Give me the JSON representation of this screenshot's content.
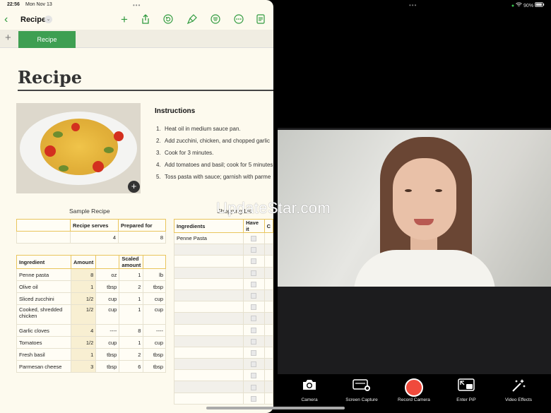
{
  "left_status": {
    "time": "22:56",
    "date": "Mon Nov 13"
  },
  "toolbar": {
    "title": "Recipe",
    "icons": [
      "back-chevron-icon",
      "add-icon",
      "share-icon",
      "undo-icon",
      "format-brush-icon",
      "menu-icon",
      "more-icon",
      "document-icon"
    ]
  },
  "sheet_tab": "Recipe",
  "heading": "Recipe",
  "instructions": {
    "title": "Instructions",
    "steps": [
      "Heat oil in medium sauce pan.",
      "Add zucchini, chicken, and chopped garlic",
      "Cook for 3 minutes.",
      "Add tomatoes and basil; cook for 5 minutes",
      "Toss pasta with sauce; garnish with parme"
    ]
  },
  "sample_caption": "Sample Recipe",
  "shopping_caption": "Shopping List",
  "serves_table": {
    "headers": [
      "",
      "Recipe serves",
      "Prepared for"
    ],
    "row": [
      "",
      "4",
      "8"
    ]
  },
  "ingredients_table": {
    "headers": [
      "Ingredient",
      "Amount",
      "",
      "Scaled amount",
      ""
    ],
    "rows": [
      [
        "Penne pasta",
        "8",
        "oz",
        "1",
        "lb"
      ],
      [
        "Olive oil",
        "1",
        "tbsp",
        "2",
        "tbsp"
      ],
      [
        "Sliced zucchini",
        "1/2",
        "cup",
        "1",
        "cup"
      ],
      [
        "Cooked, shredded chicken",
        "1/2",
        "cup",
        "1",
        "cup"
      ],
      [
        "Garlic cloves",
        "4",
        "----",
        "8",
        "----"
      ],
      [
        "Tomatoes",
        "1/2",
        "cup",
        "1",
        "cup"
      ],
      [
        "Fresh basil",
        "1",
        "tbsp",
        "2",
        "tbsp"
      ],
      [
        "Parmesan cheese",
        "3",
        "tbsp",
        "6",
        "tbsp"
      ]
    ]
  },
  "shopping_table": {
    "headers": [
      "Ingredients",
      "Have it",
      "C"
    ],
    "first_item": "Penne Pasta"
  },
  "watermark": "UpdateStar.com",
  "right_status": {
    "battery": "90%"
  },
  "controls": [
    {
      "label": "Camera",
      "icon": "camera-icon"
    },
    {
      "label": "Screen Capture",
      "icon": "screen-capture-icon"
    },
    {
      "label": "Record Camera",
      "icon": "record-icon"
    },
    {
      "label": "Enter PiP",
      "icon": "pip-icon"
    },
    {
      "label": "Video Effects",
      "icon": "magic-wand-icon"
    }
  ],
  "colors": {
    "accent_green": "#3e9f52",
    "header_yellow": "#f3d16b",
    "record_red": "#f04a3c"
  }
}
